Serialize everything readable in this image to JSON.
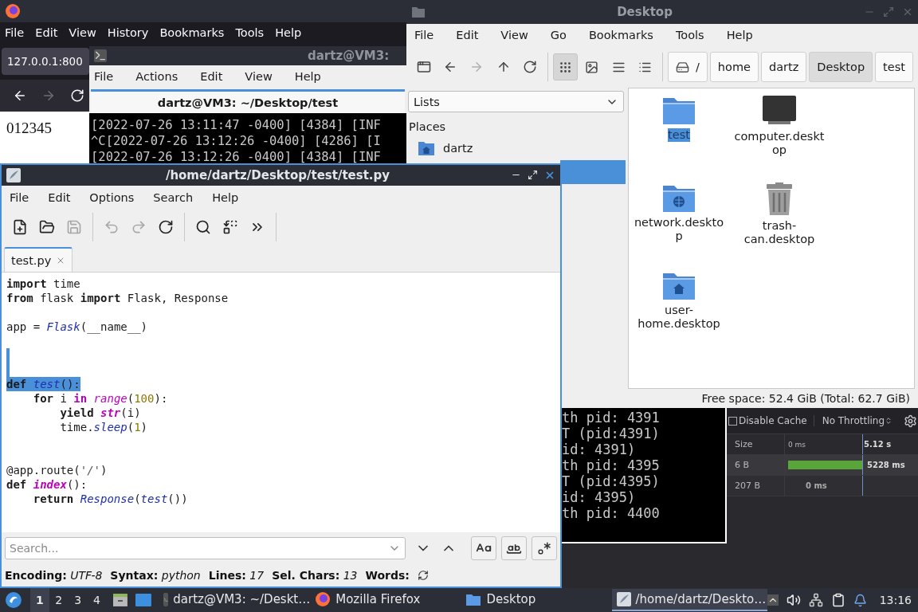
{
  "browser": {
    "menu": [
      "File",
      "Edit",
      "View",
      "History",
      "Bookmarks",
      "Tools",
      "Help"
    ],
    "tab": "127.0.0.1:800",
    "nav": [
      {
        "kind": "back",
        "disabled": false
      },
      {
        "kind": "forward",
        "disabled": true
      },
      {
        "kind": "reload",
        "disabled": false
      }
    ],
    "page_text": "012345",
    "devtools": {
      "disable_cache": {
        "label": "Disable Cache",
        "checked": false
      },
      "throttling": "No Throttling",
      "columns": [
        "Size",
        "0 ms",
        "5.12 s"
      ],
      "rows": [
        {
          "size": "6 B",
          "timing": "5228 ms",
          "kind": "bar"
        },
        {
          "size": "207 B",
          "timing": "0 ms",
          "kind": "plain"
        }
      ]
    }
  },
  "terminal": {
    "title": "dartz@VM3:",
    "menu": [
      "File",
      "Actions",
      "Edit",
      "View",
      "Help"
    ],
    "tab": "dartz@VM3: ~/Desktop/test",
    "lines_top": [
      "[2022-07-26 13:11:47 -0400] [4384] [INF",
      "^C[2022-07-26 13:12:26 -0400] [4286] [I",
      "[2022-07-26 13:12:26 -0400] [4384] [INF"
    ],
    "lines_bottom": [
      "th pid: 4391",
      "T (pid:4391)",
      "id: 4391)",
      "th pid: 4395",
      "T (pid:4395)",
      "id: 4395)",
      "th pid: 4400"
    ]
  },
  "file_manager": {
    "title": "Desktop",
    "menu": [
      "File",
      "Edit",
      "View",
      "Go",
      "Bookmarks",
      "Tools",
      "Help"
    ],
    "nav": [
      {
        "kind": "new-window",
        "disabled": false
      },
      {
        "kind": "back",
        "disabled": false
      },
      {
        "kind": "forward",
        "disabled": true
      },
      {
        "kind": "up",
        "disabled": false
      },
      {
        "kind": "reload",
        "disabled": false
      }
    ],
    "views": [
      {
        "kind": "icons",
        "selected": true
      },
      {
        "kind": "thumbnails",
        "selected": false
      },
      {
        "kind": "compact",
        "selected": false
      },
      {
        "kind": "details",
        "selected": false
      }
    ],
    "path": [
      {
        "label": "/",
        "kind": "root",
        "selected": false
      },
      {
        "label": "home",
        "kind": "dir",
        "selected": false
      },
      {
        "label": "dartz",
        "kind": "dir",
        "selected": false
      },
      {
        "label": "Desktop",
        "kind": "dir",
        "selected": true
      },
      {
        "label": "test",
        "kind": "dir",
        "selected": false
      }
    ],
    "side_select": "Lists",
    "places_heading": "Places",
    "places": [
      {
        "label": "dartz",
        "kind": "home",
        "selected": false
      },
      {
        "kind": "hidden",
        "selected": true
      }
    ],
    "files": [
      {
        "label": "test",
        "kind": "folder",
        "selected": true
      },
      {
        "label": "computer.desktop",
        "kind": "computer",
        "selected": false
      },
      {
        "label": "network.desktop",
        "kind": "network",
        "selected": false
      },
      {
        "label": "trash-can.desktop",
        "kind": "trash",
        "selected": false
      },
      {
        "label": "user-home.desktop",
        "kind": "home",
        "selected": false
      }
    ],
    "status": "Free space: 52.4 GiB (Total: 62.7 GiB)"
  },
  "editor": {
    "title": "/home/dartz/Desktop/test/test.py",
    "menu": [
      "File",
      "Edit",
      "Options",
      "Search",
      "Help"
    ],
    "toolbar": [
      {
        "kind": "new",
        "disabled": false
      },
      {
        "kind": "open",
        "disabled": false
      },
      {
        "kind": "save",
        "disabled": true
      },
      {
        "kind": "sep"
      },
      {
        "kind": "undo",
        "disabled": true
      },
      {
        "kind": "redo",
        "disabled": true
      },
      {
        "kind": "reload",
        "disabled": false
      },
      {
        "kind": "sep"
      },
      {
        "kind": "find",
        "disabled": false
      },
      {
        "kind": "replace",
        "disabled": false
      },
      {
        "kind": "more",
        "disabled": false
      },
      {
        "kind": "sep"
      }
    ],
    "tab": "test.py",
    "code": [
      {
        "selected": false,
        "tokens": [
          {
            "text": "import",
            "kind": "keyword"
          },
          {
            "text": " time",
            "kind": "plain"
          }
        ]
      },
      {
        "selected": false,
        "tokens": [
          {
            "text": "from",
            "kind": "keyword"
          },
          {
            "text": " flask ",
            "kind": "plain"
          },
          {
            "text": "import",
            "kind": "keyword"
          },
          {
            "text": " Flask, Response",
            "kind": "plain"
          }
        ]
      },
      {
        "selected": false
      },
      {
        "selected": false,
        "tokens": [
          {
            "text": "app = ",
            "kind": "plain"
          },
          {
            "text": "Flask",
            "kind": "call"
          },
          {
            "text": "(__name__)",
            "kind": "plain"
          }
        ]
      },
      {
        "selected": false
      },
      {
        "selected": true
      },
      {
        "selected": true
      },
      {
        "selected": true,
        "tokens": [
          {
            "text": "def",
            "kind": "keyword"
          },
          {
            "text": " test",
            "kind": "call"
          },
          {
            "text": "():",
            "kind": "plain"
          }
        ]
      },
      {
        "selected": false,
        "tokens": [
          {
            "text": "    for",
            "kind": "keyword"
          },
          {
            "text": " i ",
            "kind": "plain"
          },
          {
            "text": "in",
            "kind": "operator_keyword"
          },
          {
            "text": " range",
            "kind": "builtin"
          },
          {
            "text": "(",
            "kind": "plain"
          },
          {
            "text": "100",
            "kind": "number"
          },
          {
            "text": "):",
            "kind": "plain"
          }
        ]
      },
      {
        "selected": false,
        "tokens": [
          {
            "text": "        yield",
            "kind": "keyword"
          },
          {
            "text": " str",
            "kind": "definition"
          },
          {
            "text": "(i)",
            "kind": "plain"
          }
        ]
      },
      {
        "selected": false,
        "tokens": [
          {
            "text": "        time.",
            "kind": "plain"
          },
          {
            "text": "sleep",
            "kind": "call"
          },
          {
            "text": "(",
            "kind": "plain"
          },
          {
            "text": "1",
            "kind": "number"
          },
          {
            "text": ")",
            "kind": "plain"
          }
        ]
      },
      {
        "selected": false
      },
      {
        "selected": false
      },
      {
        "selected": false,
        "tokens": [
          {
            "text": "@app.route(",
            "kind": "plain"
          },
          {
            "text": "'/'",
            "kind": "string"
          },
          {
            "text": ")",
            "kind": "plain"
          }
        ]
      },
      {
        "selected": false,
        "tokens": [
          {
            "text": "def",
            "kind": "keyword"
          },
          {
            "text": " index",
            "kind": "definition"
          },
          {
            "text": "():",
            "kind": "plain"
          }
        ]
      },
      {
        "selected": false,
        "tokens": [
          {
            "text": "    return",
            "kind": "keyword"
          },
          {
            "text": " Response",
            "kind": "call"
          },
          {
            "text": "(",
            "kind": "plain"
          },
          {
            "text": "test",
            "kind": "call"
          },
          {
            "text": "())",
            "kind": "plain"
          }
        ]
      },
      {
        "selected": false
      }
    ],
    "search": {
      "placeholder": "Search..."
    },
    "status": [
      {
        "label": "Encoding:",
        "value": "UTF-8"
      },
      {
        "label": "Syntax:",
        "value": "python"
      },
      {
        "label": "Lines:",
        "value": "17"
      },
      {
        "label": "Sel. Chars:",
        "value": "13"
      },
      {
        "label": "Words:"
      }
    ]
  },
  "taskbar": {
    "workspaces": [
      {
        "label": "1",
        "selected": true
      },
      {
        "label": "2",
        "selected": false
      },
      {
        "label": "3",
        "selected": false
      },
      {
        "label": "4",
        "selected": false
      }
    ],
    "tasks": [
      {
        "label": "dartz@VM3: ~/Deskt…",
        "kind": "terminal",
        "selected": false
      },
      {
        "label": "Mozilla Firefox",
        "kind": "browser",
        "selected": false
      },
      {
        "label": "Desktop",
        "kind": "folder",
        "selected": false
      },
      {
        "label": "/home/dartz/Deskto…",
        "kind": "editor",
        "selected": true
      }
    ],
    "clock": "13:16"
  }
}
